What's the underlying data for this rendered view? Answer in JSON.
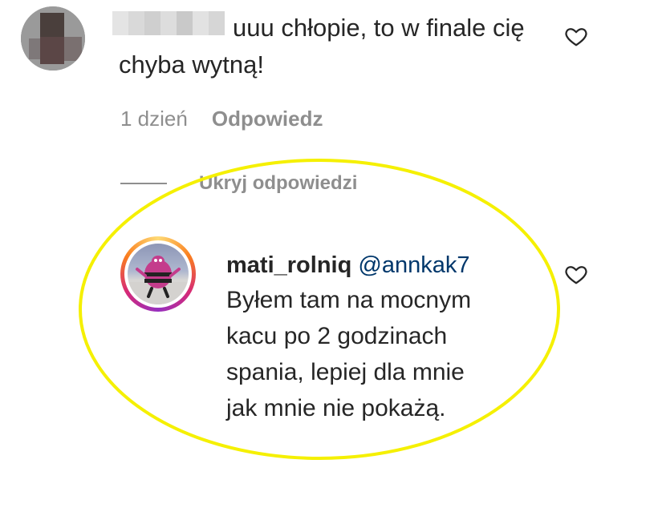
{
  "comment": {
    "text": "uuu chłopie, to w finale cię chyba wytną!",
    "time": "1 dzień",
    "reply_label": "Odpowiedz",
    "like_icon": "heart-outline-icon"
  },
  "replies_toggle": {
    "label": "Ukryj odpowiedzi"
  },
  "reply": {
    "username": "mati_rolniq",
    "mention": "@annkak7",
    "text": "Byłem tam na mocnym\nkacu po 2 godzinach\nspania, lepiej dla mnie\njak mnie nie pokażą.",
    "like_icon": "heart-outline-icon"
  },
  "colors": {
    "text": "#262626",
    "secondary": "#8e8e8e",
    "mention": "#00376b",
    "highlight": "#f5f000"
  }
}
